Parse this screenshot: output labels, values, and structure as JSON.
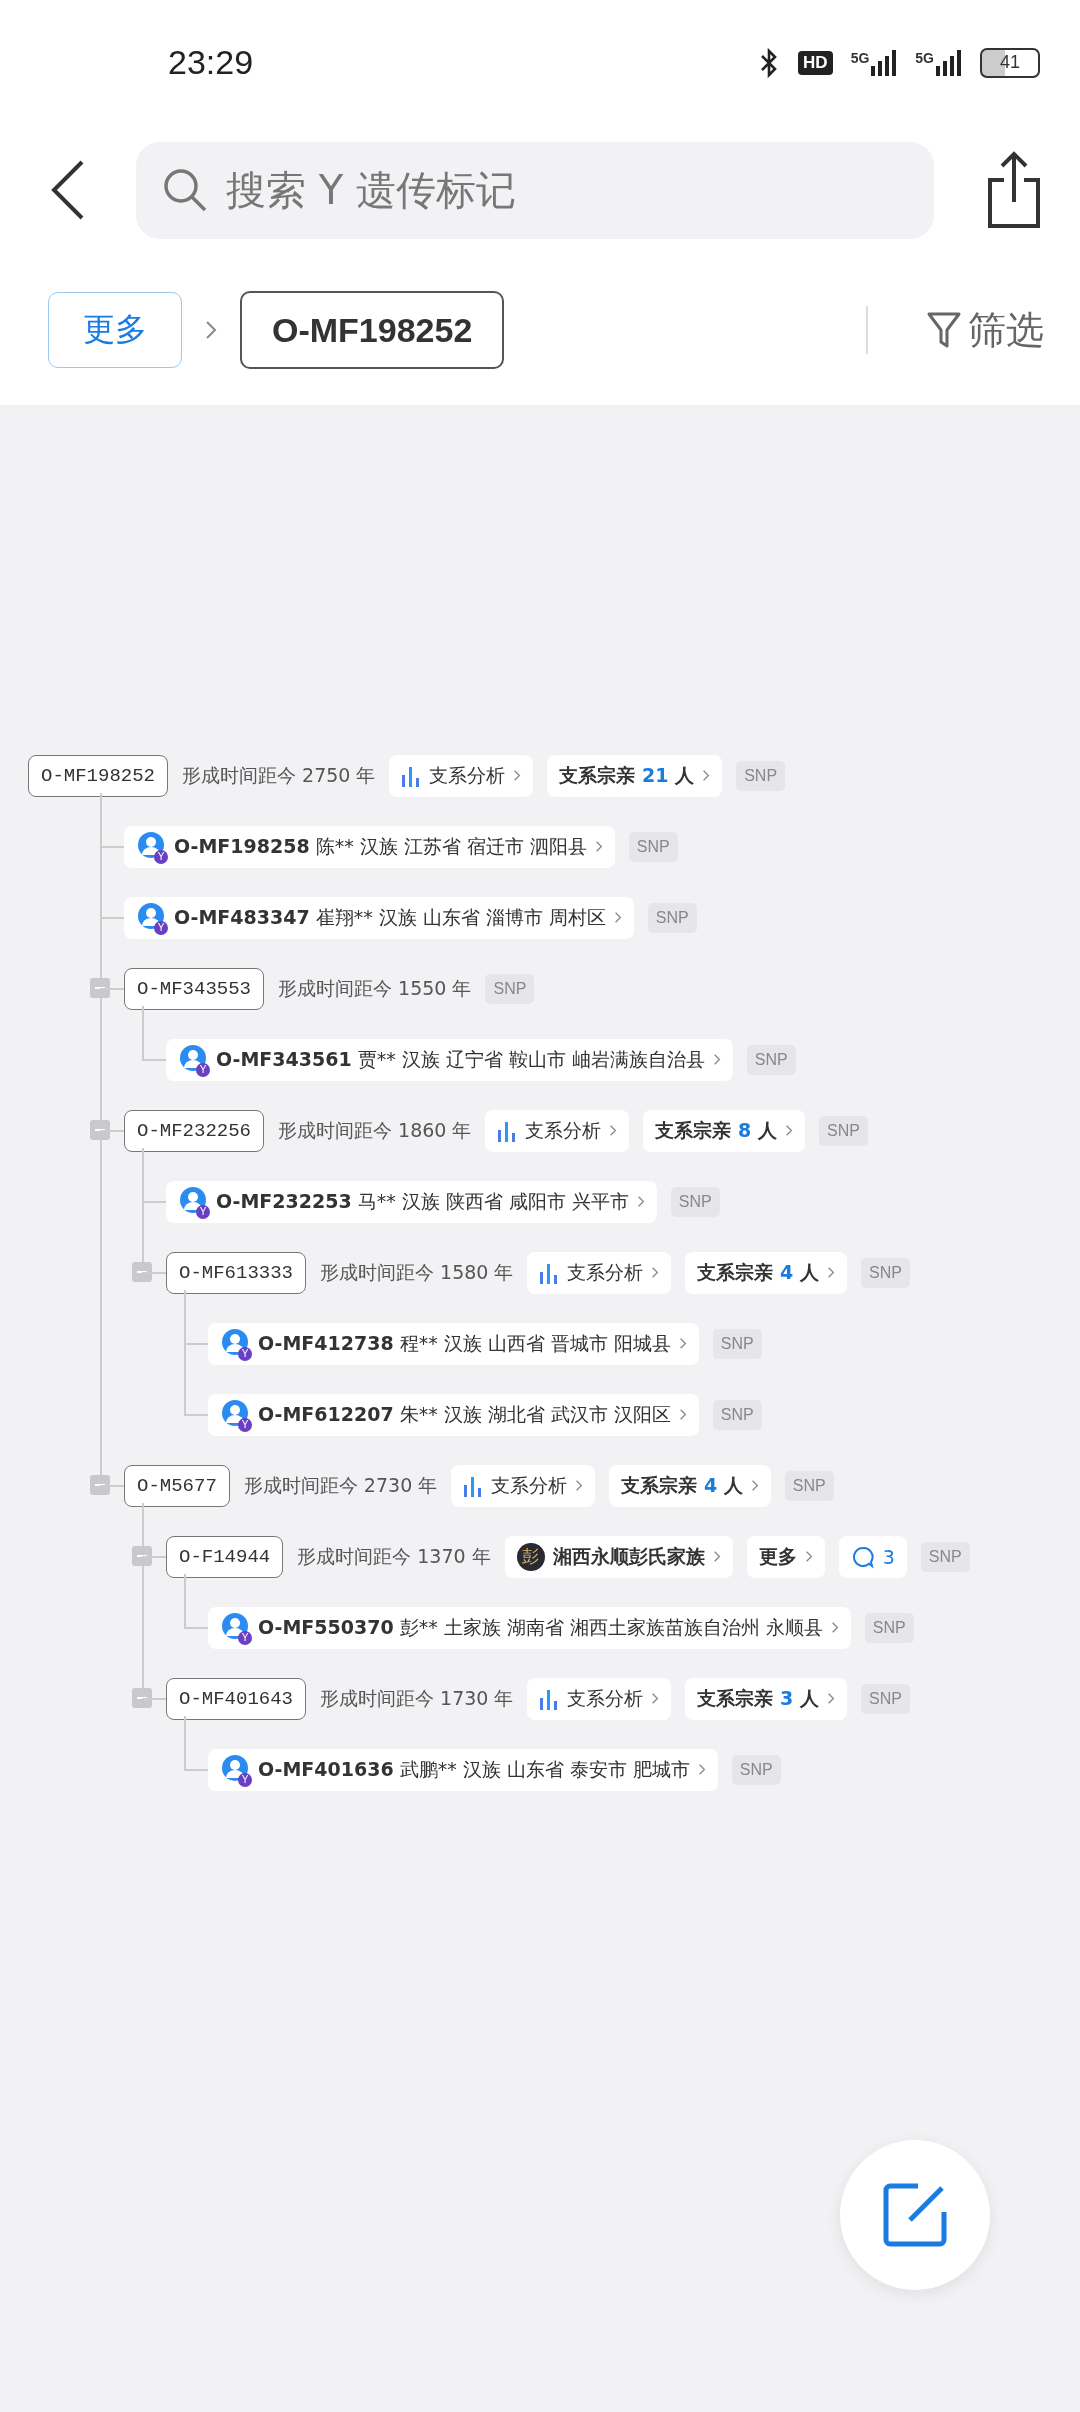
{
  "status_bar": {
    "time": "23:29",
    "hd": "HD",
    "networks": [
      "5G",
      "5G"
    ],
    "battery": "41"
  },
  "search": {
    "placeholder": "搜索 Y 遗传标记"
  },
  "breadcrumb": {
    "more": "更多",
    "current": "O-MF198252",
    "filter": "筛选"
  },
  "tree": {
    "kind": "haplogroup",
    "id": "O-MF198252",
    "age": "形成时间距今 2750 年",
    "analysis": "支系分析",
    "relatives": {
      "label": "支系宗亲",
      "count": "21",
      "unit": "人"
    },
    "tag": "SNP",
    "children": [
      {
        "kind": "person",
        "id": "O-MF198258",
        "info": "陈** 汉族 江苏省 宿迁市 泗阳县",
        "badge": "Y",
        "tag": "SNP"
      },
      {
        "kind": "person",
        "id": "O-MF483347",
        "info": "崔翔** 汉族 山东省 淄博市 周村区",
        "badge": "Y",
        "tag": "SNP"
      },
      {
        "kind": "haplogroup",
        "id": "O-MF343553",
        "age": "形成时间距今 1550 年",
        "tag": "SNP",
        "expanded": true,
        "children": [
          {
            "kind": "person",
            "id": "O-MF343561",
            "info": "贾** 汉族 辽宁省 鞍山市 岫岩满族自治县",
            "badge": "Y",
            "tag": "SNP"
          }
        ]
      },
      {
        "kind": "haplogroup",
        "id": "O-MF232256",
        "age": "形成时间距今 1860 年",
        "analysis": "支系分析",
        "relatives": {
          "label": "支系宗亲",
          "count": "8",
          "unit": "人"
        },
        "tag": "SNP",
        "expanded": true,
        "children": [
          {
            "kind": "person",
            "id": "O-MF232253",
            "info": "马** 汉族 陕西省 咸阳市 兴平市",
            "badge": "Y",
            "tag": "SNP"
          },
          {
            "kind": "haplogroup",
            "id": "O-MF613333",
            "age": "形成时间距今 1580 年",
            "analysis": "支系分析",
            "relatives": {
              "label": "支系宗亲",
              "count": "4",
              "unit": "人"
            },
            "tag": "SNP",
            "expanded": true,
            "children": [
              {
                "kind": "person",
                "id": "O-MF412738",
                "info": "程** 汉族 山西省 晋城市 阳城县",
                "badge": "Y",
                "tag": "SNP"
              },
              {
                "kind": "person",
                "id": "O-MF612207",
                "info": "朱** 汉族 湖北省 武汉市 汉阳区",
                "badge": "Y",
                "tag": "SNP"
              }
            ]
          }
        ]
      },
      {
        "kind": "haplogroup",
        "id": "O-M5677",
        "age": "形成时间距今 2730 年",
        "analysis": "支系分析",
        "relatives": {
          "label": "支系宗亲",
          "count": "4",
          "unit": "人"
        },
        "tag": "SNP",
        "expanded": true,
        "children": [
          {
            "kind": "haplogroup",
            "id": "O-F14944",
            "age": "形成时间距今 1370 年",
            "family": {
              "logo": "彭",
              "name": "湘西永顺彭氏家族"
            },
            "more": "更多",
            "comments": "3",
            "tag": "SNP",
            "expanded": true,
            "children": [
              {
                "kind": "person",
                "id": "O-MF550370",
                "info": "彭** 土家族 湖南省 湘西土家族苗族自治州 永顺县",
                "badge": "Y",
                "tag": "SNP"
              }
            ]
          },
          {
            "kind": "haplogroup",
            "id": "O-MF401643",
            "age": "形成时间距今 1730 年",
            "analysis": "支系分析",
            "relatives": {
              "label": "支系宗亲",
              "count": "3",
              "unit": "人"
            },
            "tag": "SNP",
            "expanded": true,
            "children": [
              {
                "kind": "person",
                "id": "O-MF401636",
                "info": "武鹏** 汉族 山东省 泰安市 肥城市",
                "badge": "Y",
                "tag": "SNP"
              }
            ]
          }
        ]
      }
    ]
  }
}
